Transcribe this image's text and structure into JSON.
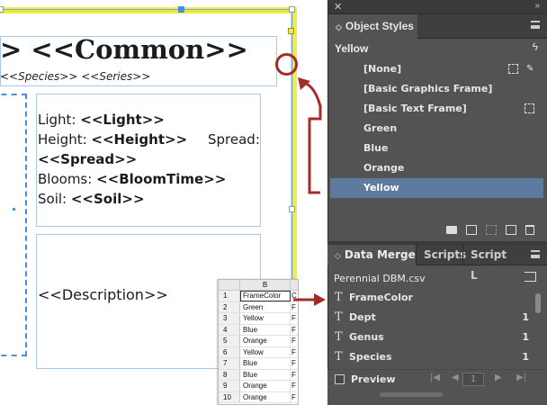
{
  "document": {
    "title": "> <<Common>>",
    "subtitle": "<<Species>> <<Series>>",
    "spec_lines": {
      "light_label": "Light: ",
      "light_value": "<<Light>>",
      "height_label": "Height: ",
      "height_value": "<<Height>>",
      "spread_label": "Spread:",
      "spread_value": "<<Spread>>",
      "blooms_label": "Blooms: ",
      "blooms_value": "<<BloomTime>>",
      "soil_label": "Soil: ",
      "soil_value": "<<Soil>>"
    },
    "description": "<<Description>>"
  },
  "spreadsheet": {
    "column_header": "B",
    "rows": [
      {
        "n": "1",
        "b": "FrameColor",
        "c": "C"
      },
      {
        "n": "2",
        "b": "Green",
        "c": "F"
      },
      {
        "n": "3",
        "b": "Yellow",
        "c": "F"
      },
      {
        "n": "4",
        "b": "Blue",
        "c": "F"
      },
      {
        "n": "5",
        "b": "Orange",
        "c": "F"
      },
      {
        "n": "6",
        "b": "Yellow",
        "c": "F"
      },
      {
        "n": "7",
        "b": "Blue",
        "c": "F"
      },
      {
        "n": "8",
        "b": "Blue",
        "c": "F"
      },
      {
        "n": "9",
        "b": "Orange",
        "c": "F"
      },
      {
        "n": "10",
        "b": "Orange",
        "c": "F"
      }
    ]
  },
  "object_styles_panel": {
    "tab_label": "Object Styles",
    "current_style": "Yellow",
    "styles": [
      "[None]",
      "[Basic Graphics Frame]",
      "[Basic Text Frame]",
      "Green",
      "Blue",
      "Orange",
      "Yellow"
    ],
    "selected_style": "Yellow"
  },
  "data_merge_panel": {
    "tabs": [
      "Data Merge",
      "Scripts",
      "Script L"
    ],
    "file_name": "Perennial DBM.csv",
    "fields": [
      {
        "name": "FrameColor",
        "count": ""
      },
      {
        "name": "Dept",
        "count": "1"
      },
      {
        "name": "Genus",
        "count": "1"
      },
      {
        "name": "Species",
        "count": "1"
      }
    ],
    "preview_label": "Preview",
    "page_value": "1"
  },
  "colors": {
    "frame_yellow": "#f4ec3e",
    "annotation_red": "#a52a2a",
    "selection_blue": "#5d7b9e",
    "panel_bg": "#535353"
  }
}
